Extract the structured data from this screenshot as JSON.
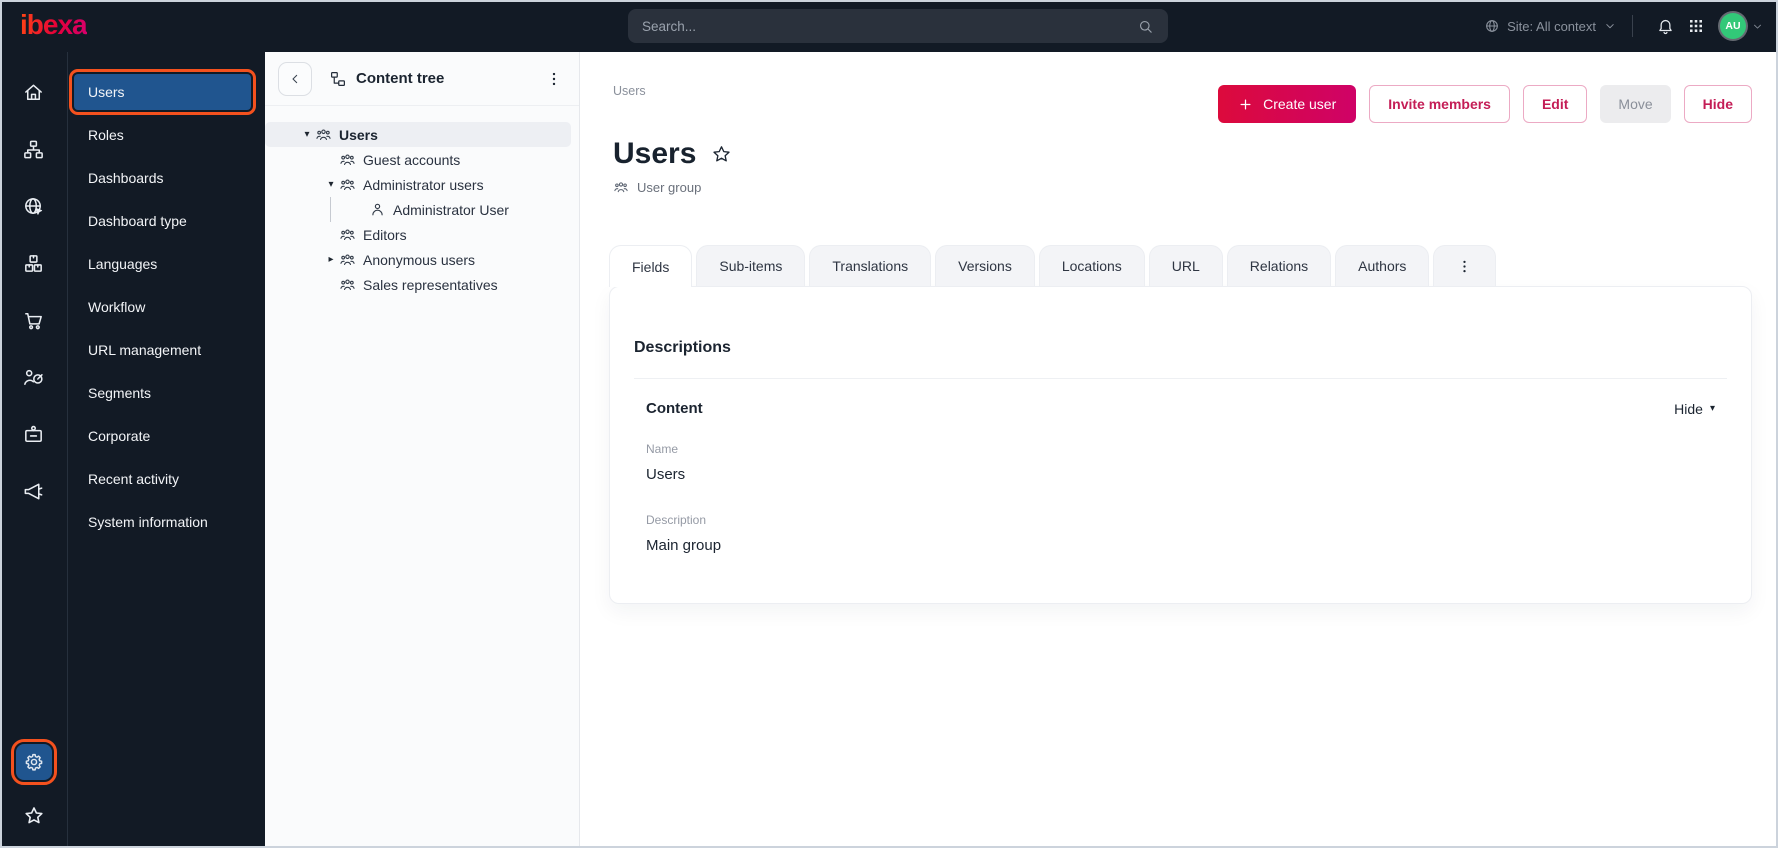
{
  "topbar": {
    "logo_text": "ibexa",
    "search": {
      "placeholder": "Search..."
    },
    "site_context": {
      "label": "Site: All context"
    },
    "avatar": {
      "initials": "AU"
    }
  },
  "nav_rail": {
    "icons": [
      "home",
      "content-structure",
      "site",
      "product-catalog",
      "commerce",
      "personalization",
      "corporate",
      "marketing"
    ],
    "bottom_icons": [
      "settings-gear",
      "favorites-star"
    ],
    "highlighted": "settings-gear"
  },
  "menu": {
    "items": [
      "Users",
      "Roles",
      "Dashboards",
      "Dashboard type",
      "Languages",
      "Workflow",
      "URL management",
      "Segments",
      "Corporate",
      "Recent activity",
      "System information"
    ],
    "selected": "Users"
  },
  "content_tree": {
    "title": "Content tree",
    "items": [
      {
        "label": "Users",
        "level": 0,
        "caret": "expanded",
        "icon": "user-group",
        "selected": true
      },
      {
        "label": "Guest accounts",
        "level": 1,
        "caret": "none",
        "icon": "user-group",
        "selected": false
      },
      {
        "label": "Administrator users",
        "level": 1,
        "caret": "expanded",
        "icon": "user-group",
        "selected": false
      },
      {
        "label": "Administrator User",
        "level": 2,
        "caret": "none",
        "icon": "user",
        "selected": false
      },
      {
        "label": "Editors",
        "level": 1,
        "caret": "none",
        "icon": "user-group",
        "selected": false
      },
      {
        "label": "Anonymous users",
        "level": 1,
        "caret": "collapsed",
        "icon": "user-group",
        "selected": false
      },
      {
        "label": "Sales representatives",
        "level": 1,
        "caret": "none",
        "icon": "user-group",
        "selected": false
      }
    ]
  },
  "main": {
    "breadcrumb": "Users",
    "page_title": "Users",
    "content_type": "User group",
    "actions": {
      "create": "Create user",
      "invite": "Invite members",
      "edit": "Edit",
      "move": "Move",
      "hide": "Hide"
    },
    "tabs": [
      "Fields",
      "Sub-items",
      "Translations",
      "Versions",
      "Locations",
      "URL",
      "Relations",
      "Authors"
    ],
    "active_tab": "Fields",
    "panel": {
      "title": "Descriptions",
      "section_title": "Content",
      "collapse_label": "Hide",
      "fields": [
        {
          "label": "Name",
          "value": "Users"
        },
        {
          "label": "Description",
          "value": "Main group"
        }
      ]
    }
  },
  "colors": {
    "topbar_bg": "#121a25",
    "selected_blue": "#20558f",
    "annotation_orange": "#f4511e",
    "brand_gradient_start": "#dc0a3c",
    "brand_gradient_end": "#cf0267",
    "outline_button_text": "#c41d56",
    "avatar_green": "#32c878"
  }
}
